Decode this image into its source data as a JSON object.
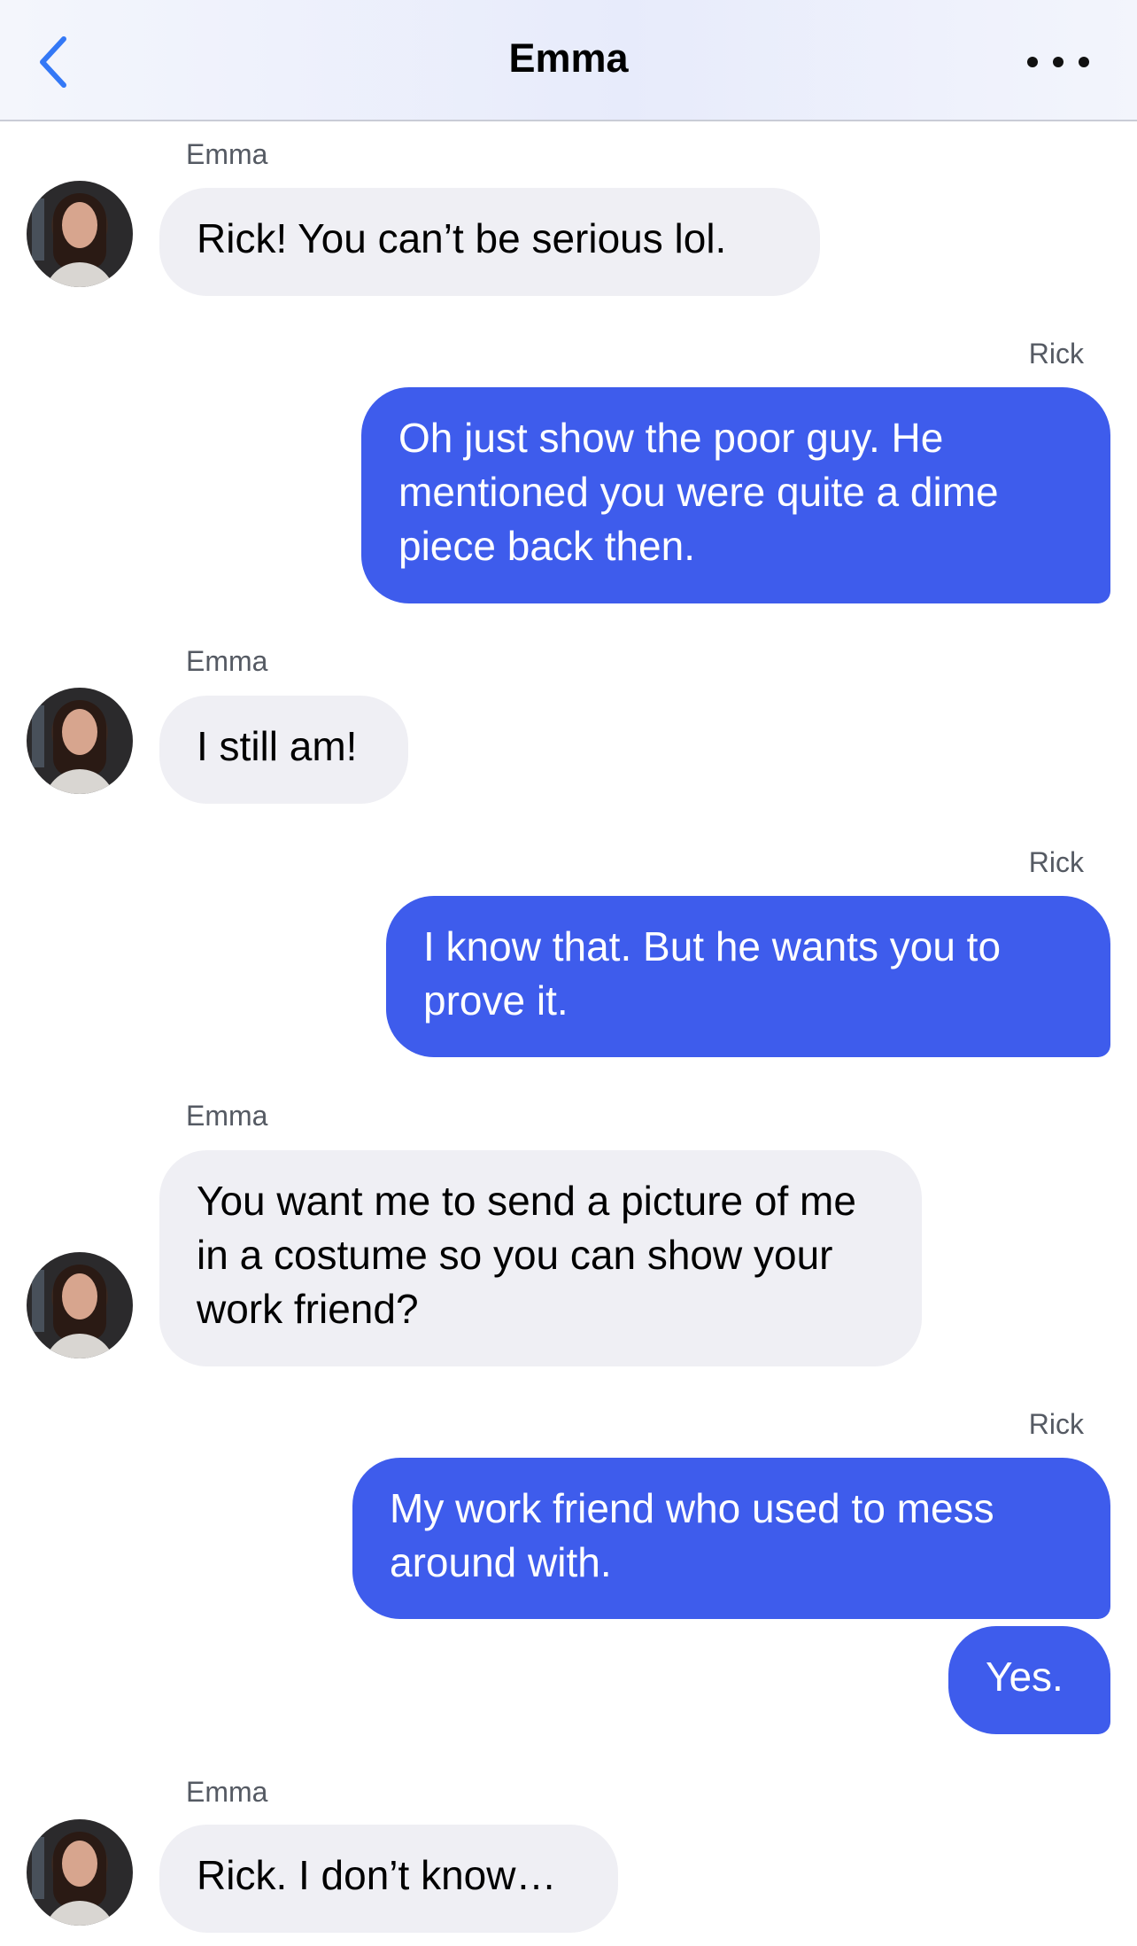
{
  "header": {
    "title": "Emma",
    "back_icon": "chevron-left-icon",
    "more_icon": "ellipsis-icon",
    "accent": "#3478f6"
  },
  "colors": {
    "outgoing_bubble": "#3e5cec",
    "incoming_bubble": "#efeff4"
  },
  "messages": [
    {
      "sender": "Emma",
      "text": "Rick! You can’t be serious lol.",
      "direction": "incoming"
    },
    {
      "sender": "Rick",
      "text": "Oh just show the poor guy. He mentioned you were quite a dime piece back then.",
      "direction": "outgoing"
    },
    {
      "sender": "Emma",
      "text": "I still am!",
      "direction": "incoming"
    },
    {
      "sender": "Rick",
      "text": "I know that. But he wants you to prove it.",
      "direction": "outgoing"
    },
    {
      "sender": "Emma",
      "text": "You want me to send a picture of me in a costume so you can show your work friend?",
      "direction": "incoming"
    },
    {
      "sender": "Rick",
      "text": "My work friend who used to mess around with.",
      "direction": "outgoing"
    },
    {
      "sender": "",
      "text": "Yes.",
      "direction": "outgoing"
    },
    {
      "sender": "Emma",
      "text": "Rick. I don’t know…",
      "direction": "incoming"
    }
  ]
}
